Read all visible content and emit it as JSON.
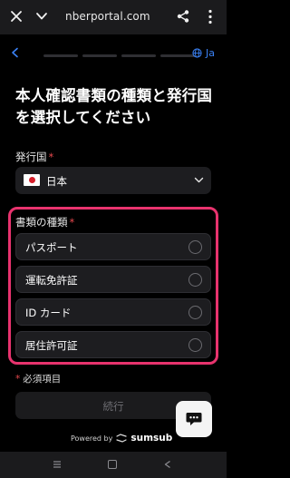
{
  "browser": {
    "url": "nberportal.com",
    "icons": [
      "close-icon",
      "chevron-down-icon",
      "share-icon",
      "more-vert-icon"
    ]
  },
  "header": {
    "progress_steps": 4,
    "language": "Ja"
  },
  "title": "本人確認書類の種類と発行国を選択してください",
  "country": {
    "label": "発行国",
    "required_mark": "*",
    "value": "日本"
  },
  "document": {
    "label": "書類の種類",
    "required_mark": "*",
    "options": [
      {
        "label": "パスポート",
        "selected": false
      },
      {
        "label": "運転免許証",
        "selected": false
      },
      {
        "label": "ID カード",
        "selected": false
      },
      {
        "label": "居住許可証",
        "selected": false
      }
    ]
  },
  "required_note": {
    "mark": "*",
    "text": "必須項目"
  },
  "continue_button": "続行",
  "powered_by": {
    "text": "Powered by",
    "brand": "sumsub"
  },
  "colors": {
    "accent": "#3b82f6",
    "highlight_border": "#e8336e",
    "required": "#e5484d"
  }
}
